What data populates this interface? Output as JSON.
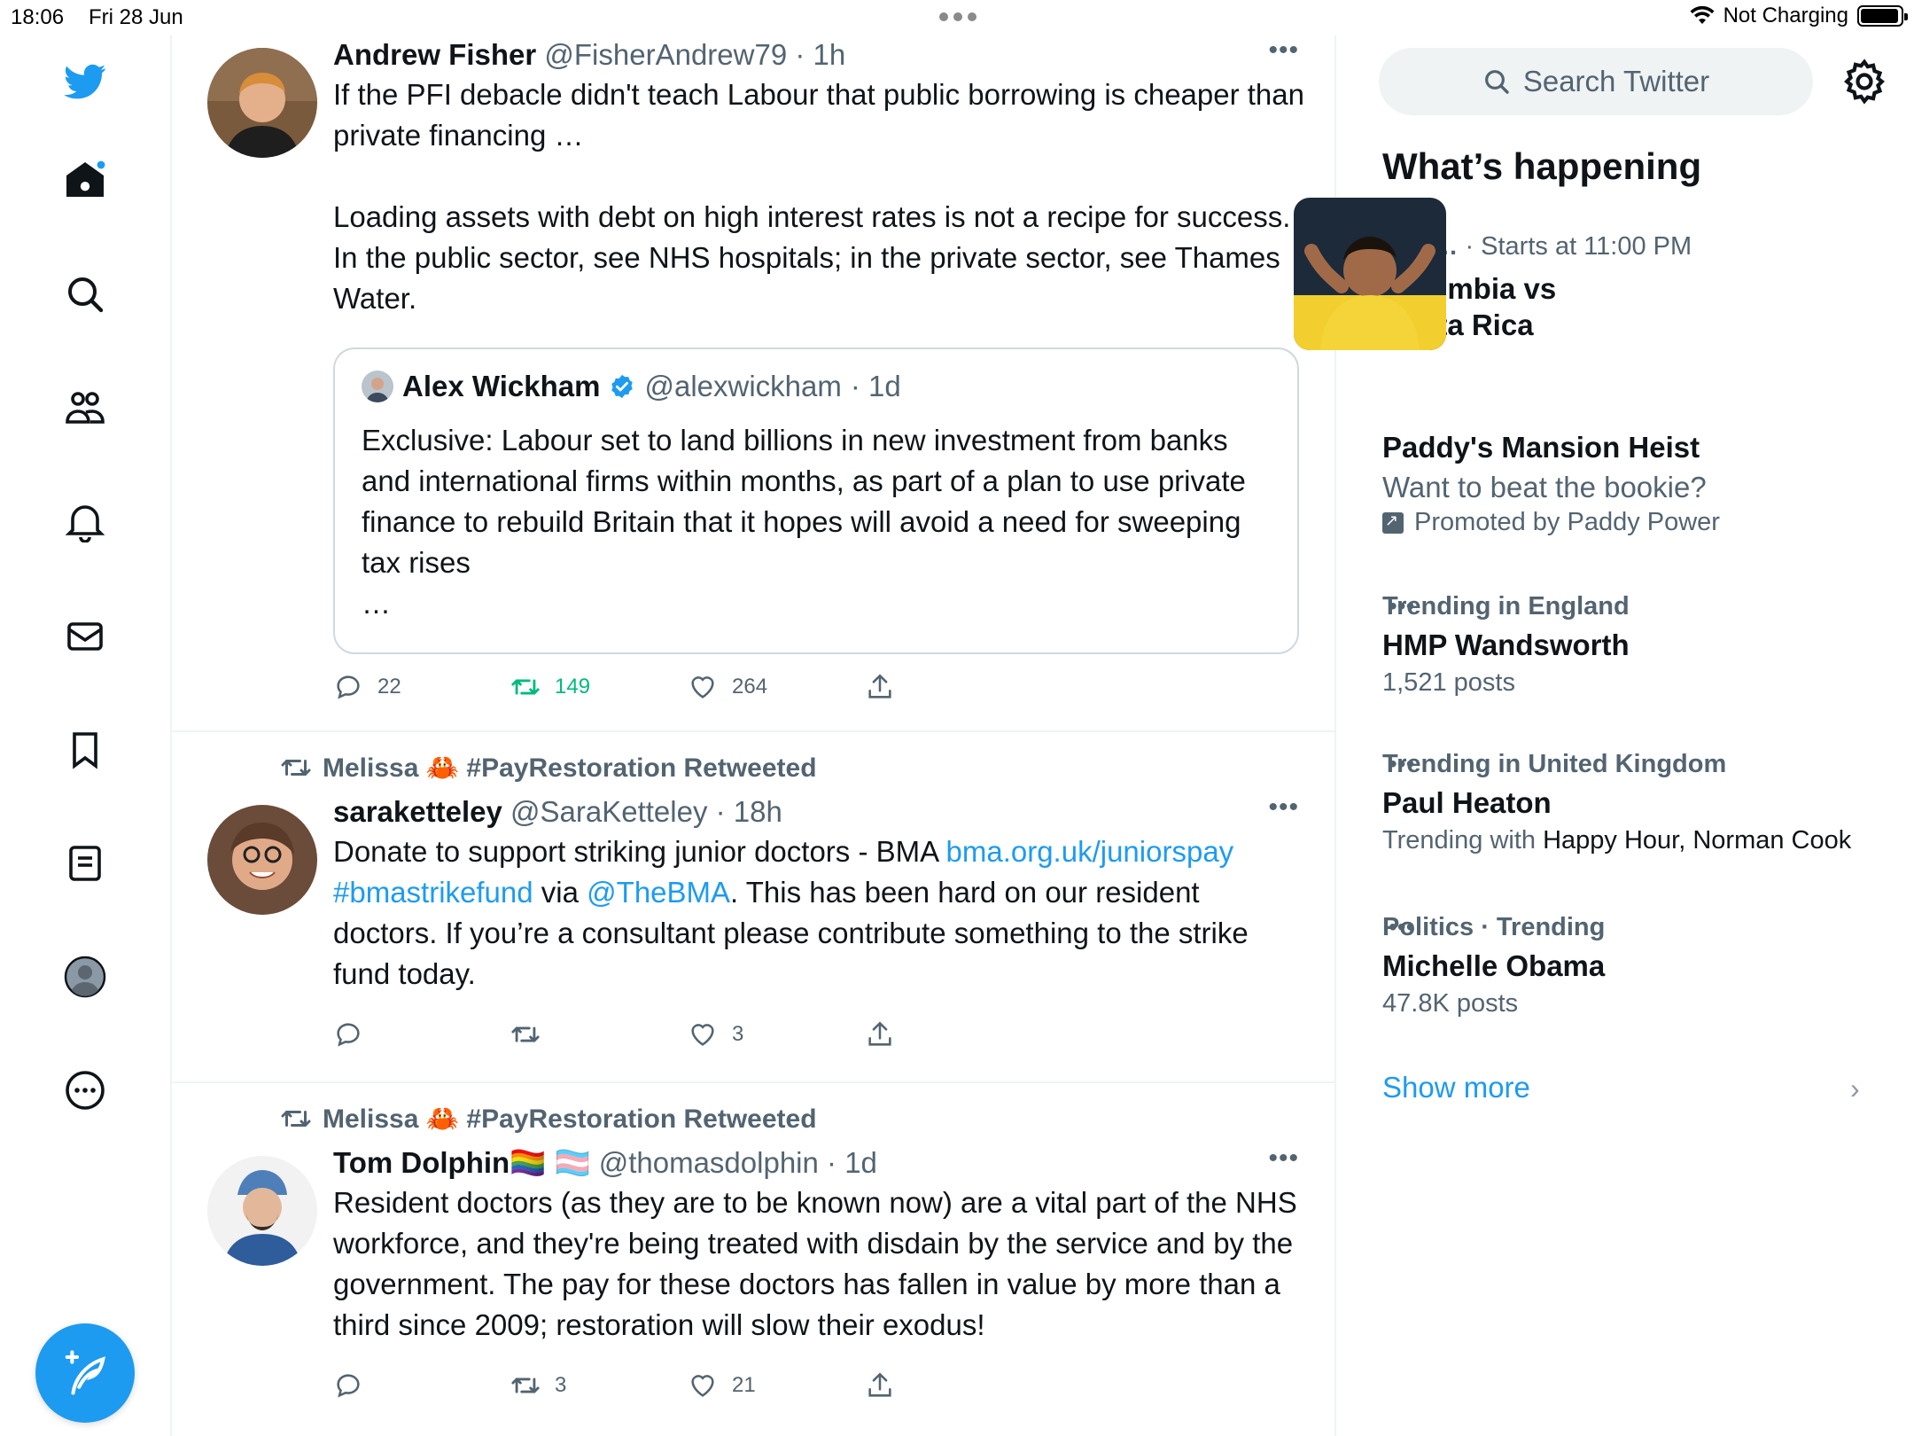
{
  "status_bar": {
    "time": "18:06",
    "date": "Fri 28 Jun",
    "charging": "Not Charging",
    "battery_level": 0.95
  },
  "colors": {
    "accent": "#1d9bf0",
    "retweet_active": "#00ba7c",
    "secondary_text": "#536471",
    "divider": "#eff3f4"
  },
  "left_nav": {
    "icons": [
      "twitter-logo",
      "home-icon",
      "explore-icon",
      "communities-icon",
      "notifications-icon",
      "messages-icon",
      "bookmarks-icon",
      "lists-icon",
      "profile-icon",
      "more-icon"
    ],
    "compose_icon": "compose-icon"
  },
  "timeline": {
    "tweets": [
      {
        "name": "Andrew Fisher",
        "handle": "@FisherAndrew79",
        "time": "· 1h",
        "text": "If the PFI debacle didn't teach Labour that public borrowing is cheaper than private financing …\n\nLoading assets with debt on high interest rates is not a recipe for success. In the public sector, see NHS hospitals; in the private sector, see Thames Water.",
        "quote": {
          "name": "Alex Wickham",
          "handle": "@alexwickham",
          "time": "· 1d",
          "text": "Exclusive: Labour set to land billions in new investment from banks and international firms within months, as part of a plan to use private finance to rebuild Britain that it hopes will avoid a need for sweeping tax rises\n…"
        },
        "replies": "22",
        "retweets": "149",
        "likes": "264"
      },
      {
        "retweeted_by": "Melissa 🦀 #PayRestoration Retweeted",
        "name": "saraketteley",
        "handle": "@SaraKetteley",
        "time": "· 18h",
        "text_1": "Donate to support striking junior doctors - BMA ",
        "link_1": "bma.org.uk/juniorspay",
        "link_2": "#bmastrikefund",
        "text_2": " via ",
        "link_3": "@TheBMA",
        "text_3": ". This has been hard on our resident doctors. If you’re a consultant please contribute something to the strike fund today.",
        "replies": "",
        "retweets": "",
        "likes": "3"
      },
      {
        "retweeted_by": "Melissa 🦀 #PayRestoration Retweeted",
        "name": "Tom Dolphin",
        "name_flags": "🏳️‍🌈 🏳️‍⚧️",
        "handle": "@thomasdolphin",
        "time": "· 1d",
        "text": "Resident doctors (as they are to be known now) are a vital part of the NHS workforce, and they're being treated with disdain by the service and by the government. The pay for these doctors has fallen in value by more than a third since 2009; restoration will slow their exodus!",
        "replies": "",
        "retweets": "3",
        "likes": "21"
      }
    ]
  },
  "sidebar": {
    "search_placeholder": "Search Twitter",
    "section_title": "What’s happening",
    "trends": [
      {
        "context": "Cop…",
        "context_extra": "· Starts at 11:00 PM",
        "name": "Colombia vs Costa Rica"
      },
      {
        "name": "Paddy's Mansion Heist",
        "subtitle": "Want to beat the bookie?",
        "promoted": "Promoted by Paddy Power"
      },
      {
        "context": "Trending in England",
        "name": "HMP Wandsworth",
        "subtitle": "1,521 posts"
      },
      {
        "context": "Trending in United Kingdom",
        "name": "Paul Heaton",
        "subtitle_prefix": "Trending with ",
        "subtitle_names": "Happy Hour, Norman Cook"
      },
      {
        "context": "Politics · Trending",
        "name": "Michelle Obama",
        "subtitle": "47.8K posts"
      }
    ],
    "show_more": "Show more"
  }
}
